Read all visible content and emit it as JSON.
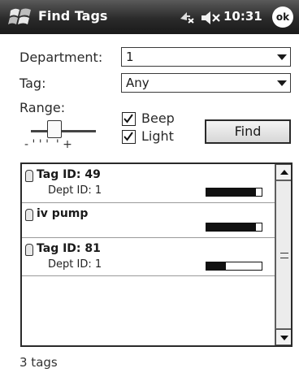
{
  "titlebar": {
    "app_title": "Find Tags",
    "clock": "10:31",
    "ok_label": "ok"
  },
  "form": {
    "department_label": "Department:",
    "department_value": "1",
    "tag_label": "Tag:",
    "tag_value": "Any",
    "range_label": "Range:",
    "range_ticks": "- ' ' '  ' +",
    "beep_label": "Beep",
    "beep_checked": true,
    "light_label": "Light",
    "light_checked": true,
    "find_label": "Find"
  },
  "list": {
    "items": [
      {
        "title": "Tag ID: 49",
        "subtitle": "Dept ID: 1",
        "signal": 0.9
      },
      {
        "title": "iv pump",
        "subtitle": "",
        "signal": 0.9
      },
      {
        "title": "Tag ID: 81",
        "subtitle": "Dept ID: 1",
        "signal": 0.35
      }
    ]
  },
  "status": {
    "text": "3 tags"
  },
  "colors": {
    "titlebar": "#1a1a1a",
    "scrollbar": "#b4b4b4"
  }
}
